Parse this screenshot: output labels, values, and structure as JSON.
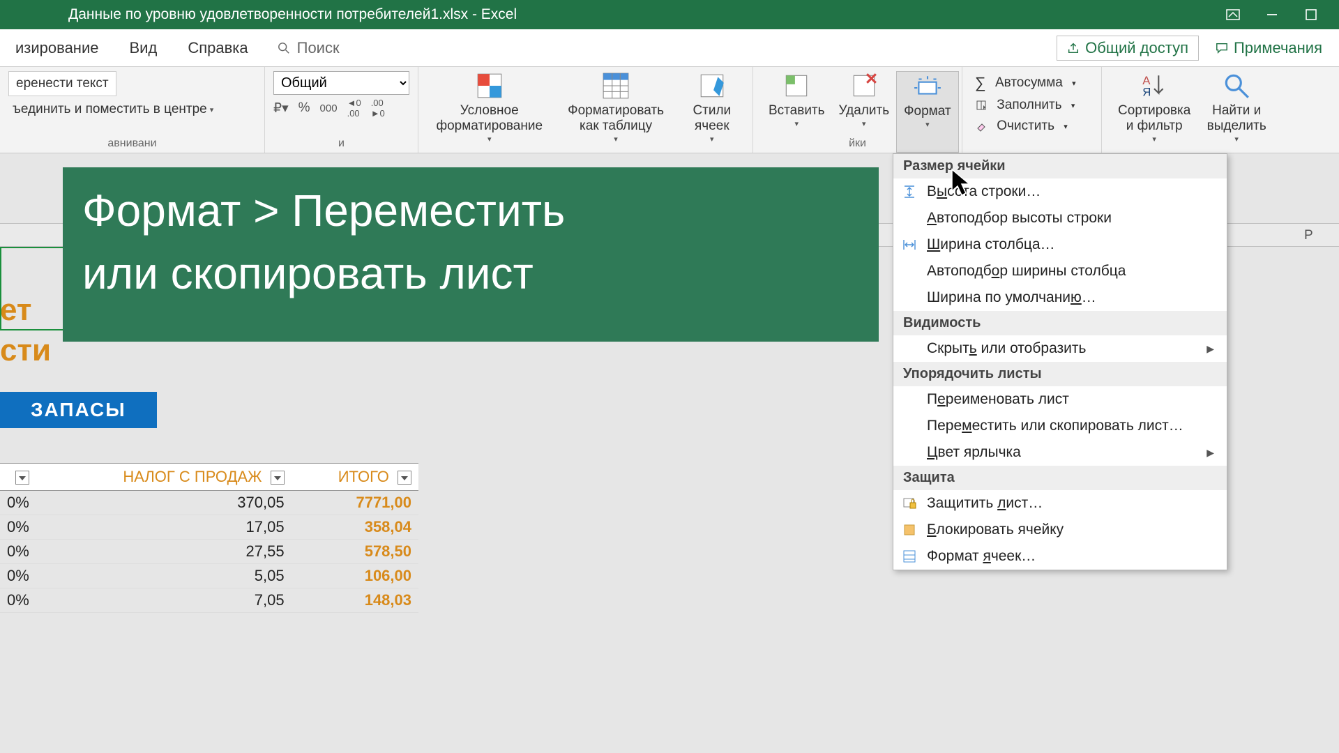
{
  "titlebar": {
    "filename": "Данные по уровню удовлетворенности потребителей1.xlsx  -  Excel"
  },
  "ribbon_tabs": {
    "tab1": "изирование",
    "tab2": "Вид",
    "tab3": "Справка",
    "search": "Поиск",
    "share": "Общий доступ",
    "comments": "Примечания"
  },
  "ribbon": {
    "align_group": "авнивани",
    "wrap_text": "еренести текст",
    "merge_center": "ъединить и поместить в центре",
    "number_group_label": "и",
    "number_format": "Общий",
    "cond_format": "Условное форматирование",
    "format_table": "Форматировать как таблицу",
    "cell_styles": "Стили ячеек",
    "insert": "Вставить",
    "delete": "Удалить",
    "format": "Формат",
    "cells_group": "йки",
    "autosum": "Автосумма",
    "fill": "Заполнить",
    "clear": "Очистить",
    "sort_filter": "Сортировка и фильтр",
    "find_select": "Найти и выделить"
  },
  "format_menu": {
    "sec_cellsize": "Размер ячейки",
    "row_height": "Высота строки…",
    "autofit_row": "Автоподбор высоты строки",
    "col_width": "Ширина столбца…",
    "autofit_col": "Автоподбор ширины столбца",
    "default_width": "Ширина по умолчанию…",
    "sec_visibility": "Видимость",
    "hide_unhide": "Скрыть или отобразить",
    "sec_organize": "Упорядочить листы",
    "rename_sheet": "Переименовать лист",
    "move_copy": "Переместить или скопировать лист…",
    "tab_color": "Цвет ярлычка",
    "sec_protect": "Защита",
    "protect_sheet": "Защитить лист…",
    "lock_cell": "Блокировать ячейку",
    "format_cells": "Формат ячеек…"
  },
  "banner": {
    "line1": "Формат > Переместить",
    "line2": "или скопировать лист"
  },
  "col_headers": {
    "p": "P"
  },
  "sheet": {
    "heading_part1": "ет",
    "heading_part2": "сти",
    "chip": "ЗАПАСЫ",
    "col_tax": "НАЛОГ С ПРОДАЖ",
    "col_total": "ИТОГО",
    "rows": [
      {
        "pct": "0%",
        "tax": "370,05",
        "total": "7771,00"
      },
      {
        "pct": "0%",
        "tax": "17,05",
        "total": "358,04"
      },
      {
        "pct": "0%",
        "tax": "27,55",
        "total": "578,50"
      },
      {
        "pct": "0%",
        "tax": "5,05",
        "total": "106,00"
      },
      {
        "pct": "0%",
        "tax": "7,05",
        "total": "148,03"
      }
    ]
  }
}
